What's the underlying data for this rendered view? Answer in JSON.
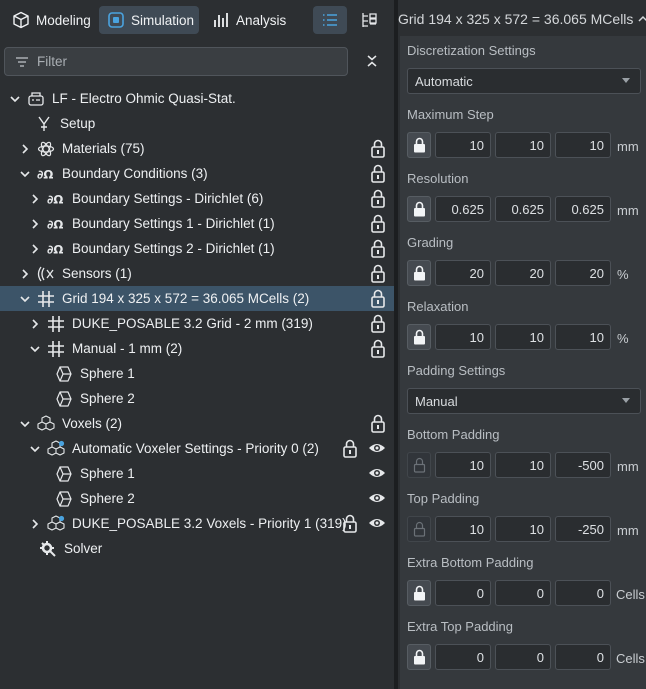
{
  "tabs": [
    {
      "label": "Modeling",
      "icon": "cube-icon"
    },
    {
      "label": "Simulation",
      "icon": "simulation-icon",
      "active": true
    },
    {
      "label": "Analysis",
      "icon": "bar-chart-icon"
    }
  ],
  "filter": {
    "placeholder": "Filter"
  },
  "tree": [
    {
      "label": "LF - Electro Ohmic Quasi-Stat.",
      "icon": "simulation-node-icon"
    },
    {
      "label": "Setup",
      "icon": "setup-icon"
    },
    {
      "label": "Materials (75)",
      "icon": "atom-icon"
    },
    {
      "label": "Boundary Conditions (3)",
      "icon": "boundary-icon"
    },
    {
      "label": "Boundary Settings - Dirichlet (6)",
      "icon": "boundary-icon"
    },
    {
      "label": "Boundary Settings 1 - Dirichlet (1)",
      "icon": "boundary-icon"
    },
    {
      "label": "Boundary Settings 2 - Dirichlet (1)",
      "icon": "boundary-icon"
    },
    {
      "label": "Sensors (1)",
      "icon": "sensor-icon"
    },
    {
      "label": "Grid 194 x 325 x 572 = 36.065 MCells (2)",
      "icon": "grid-icon"
    },
    {
      "label": "DUKE_POSABLE 3.2 Grid - 2 mm (319)",
      "icon": "grid-icon"
    },
    {
      "label": "Manual - 1 mm (2)",
      "icon": "grid-icon"
    },
    {
      "label": "Sphere 1",
      "icon": "sphere-icon"
    },
    {
      "label": "Sphere 2",
      "icon": "sphere-icon"
    },
    {
      "label": "Voxels (2)",
      "icon": "voxels-icon"
    },
    {
      "label": "Automatic Voxeler Settings - Priority 0 (2)",
      "icon": "voxeler-icon"
    },
    {
      "label": "Sphere 1",
      "icon": "sphere-icon"
    },
    {
      "label": "Sphere 2",
      "icon": "sphere-icon"
    },
    {
      "label": "DUKE_POSABLE 3.2 Voxels - Priority 1 (319)",
      "icon": "voxeler-icon"
    },
    {
      "label": "Solver",
      "icon": "solver-icon"
    }
  ],
  "props": {
    "header": "Grid 194 x 325 x 572 = 36.065 MCells",
    "discretization_label": "Discretization Settings",
    "discretization_value": "Automatic",
    "max_step_label": "Maximum Step",
    "max_step": [
      "10",
      "10",
      "10"
    ],
    "max_step_unit": "mm",
    "resolution_label": "Resolution",
    "resolution": [
      "0.625",
      "0.625",
      "0.625"
    ],
    "resolution_unit": "mm",
    "grading_label": "Grading",
    "grading": [
      "20",
      "20",
      "20"
    ],
    "grading_unit": "%",
    "relaxation_label": "Relaxation",
    "relaxation": [
      "10",
      "10",
      "10"
    ],
    "relaxation_unit": "%",
    "padding_label": "Padding Settings",
    "padding_value": "Manual",
    "bottom_padding_label": "Bottom Padding",
    "bottom_padding": [
      "10",
      "10",
      "-500"
    ],
    "bottom_padding_unit": "mm",
    "top_padding_label": "Top Padding",
    "top_padding": [
      "10",
      "10",
      "-250"
    ],
    "top_padding_unit": "mm",
    "extra_bottom_label": "Extra Bottom Padding",
    "extra_bottom": [
      "0",
      "0",
      "0"
    ],
    "extra_bottom_unit": "Cells",
    "extra_top_label": "Extra Top Padding",
    "extra_top": [
      "0",
      "0",
      "0"
    ],
    "extra_top_unit": "Cells"
  },
  "colors": {
    "accent": "#4aa3df",
    "selected_row": "#3c5468"
  }
}
